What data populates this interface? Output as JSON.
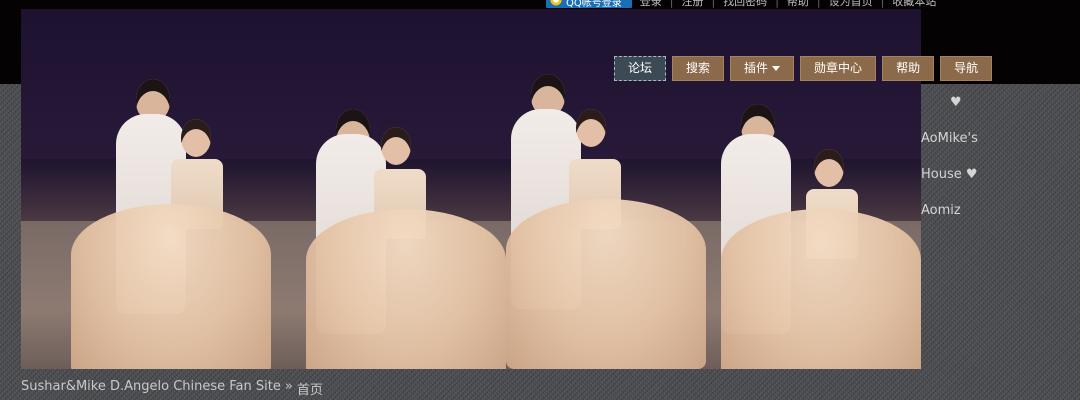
{
  "topbar": {
    "qq_login_label": "QQ帐号登录",
    "links": [
      "登录",
      "注册",
      "找回密码",
      "帮助",
      "设为首页",
      "收藏本站"
    ]
  },
  "nav": {
    "items": [
      {
        "label": "论坛",
        "active": true,
        "dropdown": false
      },
      {
        "label": "搜索",
        "active": false,
        "dropdown": false
      },
      {
        "label": "插件",
        "active": false,
        "dropdown": true
      },
      {
        "label": "勋章中心",
        "active": false,
        "dropdown": false
      },
      {
        "label": "帮助",
        "active": false,
        "dropdown": false
      },
      {
        "label": "导航",
        "active": false,
        "dropdown": false
      }
    ]
  },
  "side_title": {
    "heart": "♥",
    "line1": "AoMike's",
    "line2": "House ♥",
    "line3": "Aomiz"
  },
  "breadcrumb": {
    "site": "Sushar&Mike D.Angelo Chinese Fan Site",
    "separator": "»",
    "current": "首页"
  },
  "colors": {
    "nav_bg": "#8a6a4a",
    "nav_active_bg": "#3c4a55",
    "topbar_bg": "#050203",
    "page_bg": "#4a4b4f"
  }
}
